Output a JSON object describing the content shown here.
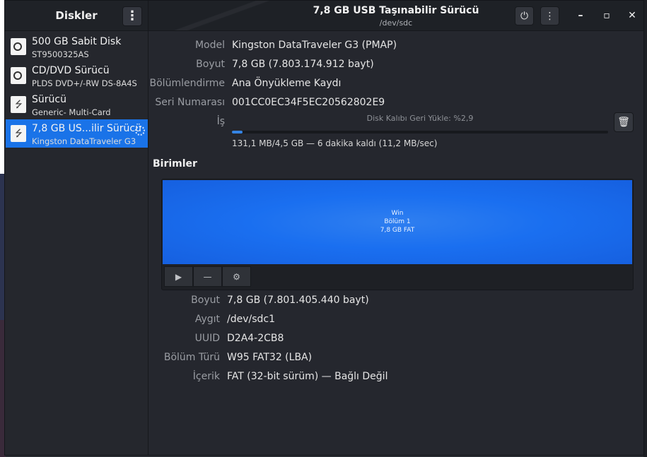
{
  "sidebar": {
    "title": "Diskler",
    "disks": [
      {
        "name": "500 GB Sabit Disk",
        "sub": "ST9500325AS",
        "icon": "hard-disk-icon"
      },
      {
        "name": "CD/DVD Sürücü",
        "sub": "PLDS DVD+/-RW DS-8A4S",
        "icon": "optical-drive-icon"
      },
      {
        "name": "Sürücü",
        "sub": "Generic- Multi-Card",
        "icon": "usb-drive-icon"
      },
      {
        "name": "7,8 GB US...ilir Sürücü",
        "sub": "Kingston DataTraveler G3",
        "icon": "usb-drive-icon",
        "selected": true
      }
    ]
  },
  "header": {
    "title": "7,8 GB USB Taşınabilir Sürücü",
    "subtitle": "/dev/sdc"
  },
  "drive": {
    "rows": [
      {
        "label": "Model",
        "value": "Kingston DataTraveler G3 (PMAP)"
      },
      {
        "label": "Boyut",
        "value": "7,8 GB (7.803.174.912 bayt)"
      },
      {
        "label": "Bölümlendirme",
        "value": "Ana Önyükleme Kaydı"
      },
      {
        "label": "Seri Numarası",
        "value": "001CC0EC34F5EC20562802E9"
      },
      {
        "label": "İş",
        "value": ""
      }
    ],
    "job": {
      "text": "Disk Kalıbı Geri Yükle: %2,9",
      "progress": 0.029,
      "stats": "131,1 MB/4,5 GB — 6 dakika kaldı (11,2 MB/sec)"
    }
  },
  "volumes": {
    "section_title": "Birimler",
    "partition": {
      "line1": "Win",
      "line2": "Bölüm 1",
      "line3": "7,8 GB FAT",
      "color": "#1a6ff0"
    },
    "rows": [
      {
        "label": "Boyut",
        "value": "7,8 GB (7.801.405.440 bayt)"
      },
      {
        "label": "Aygıt",
        "value": "/dev/sdc1"
      },
      {
        "label": "UUID",
        "value": "D2A4-2CB8"
      },
      {
        "label": "Bölüm Türü",
        "value": "W95 FAT32 (LBA)"
      },
      {
        "label": "İçerik",
        "value": "FAT (32-bit sürüm) — Bağlı Değil"
      }
    ]
  },
  "colors": {
    "accent": "#1a73e8",
    "progress": "#3584e4"
  }
}
